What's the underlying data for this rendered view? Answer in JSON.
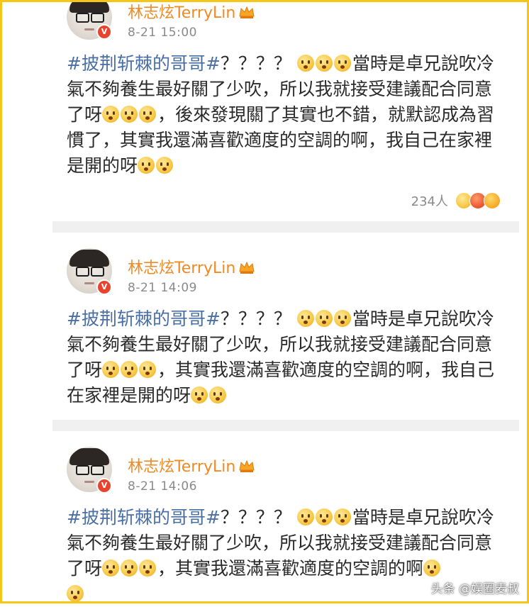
{
  "posts": [
    {
      "username": "林志炫TerryLin",
      "time": "8-21 15:00",
      "hashtag": "#披荆斩棘的哥哥#",
      "segments": [
        "？？？？",
        "當時是卓兄說吹冷氣不夠養生最好關了少吹，所以我就接受建議配合同意了呀",
        "，後來發現關了其實也不錯，就默認成為習慣了，其實我還滿喜歡適度的空調的啊，我自己在家裡是開的呀"
      ],
      "reactions_count": "234人"
    },
    {
      "username": "林志炫TerryLin",
      "time": "8-21 14:09",
      "hashtag": "#披荆斩棘的哥哥#",
      "segments": [
        "？？？？",
        "當時是卓兄說吹冷氣不夠養生最好關了少吹，所以我就接受建議配合同意了呀",
        "，其實我還滿喜歡適度的空調的啊，我自己在家裡是開的呀"
      ]
    },
    {
      "username": "林志炫TerryLin",
      "time": "8-21 14:06",
      "hashtag": "#披荆斩棘的哥哥#",
      "segments": [
        "？？？？",
        "當時是卓兄說吹冷氣不夠養生最好關了少吹，所以我就接受建議配合同意了呀",
        "，其實我還滿喜歡適度的空調的啊"
      ]
    }
  ],
  "watermark": "头条 @娱圈麦叔",
  "colors": {
    "username": "#f08a24",
    "hashtag": "#4a6fa5",
    "verified_badge": "#e8442d",
    "frame": "#f5c518"
  },
  "icons": {
    "verified": "verified-v-badge-icon",
    "crown": "crown-icon",
    "emoji": "thinking-face-emoji-icon"
  }
}
